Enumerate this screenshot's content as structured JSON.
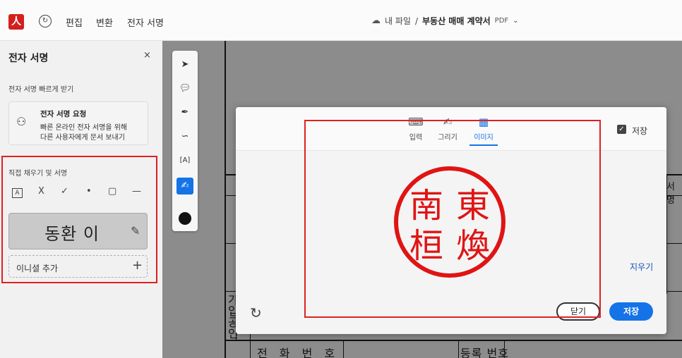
{
  "topbar": {
    "logo_glyph": "人",
    "nav": [
      "편집",
      "변환",
      "전자 서명"
    ],
    "breadcrumb": {
      "folder": "내 파일",
      "separator": "/",
      "document": "부동산 매매 계약서",
      "format": "PDF"
    }
  },
  "left_panel": {
    "title": "전자 서명",
    "close": "×",
    "quick_section": "전자 서명 빠르게 받기",
    "request_card": {
      "title": "전자 서명 요청",
      "desc_line1": "빠른 온라인 전자 서명을 위해",
      "desc_line2": "다른 사용자에게 문서 보내기"
    },
    "fill_section": "직접 채우기 및 서명",
    "tools": [
      "A",
      "X",
      "✓",
      "•",
      "▢",
      "—"
    ],
    "signature_text": "동환 이",
    "initial_label": "이니셜 추가",
    "initial_add": "+"
  },
  "rail": {
    "tools": [
      "select-tool",
      "comment-tool",
      "draw-tool",
      "lasso-tool",
      "text-tool",
      "sign-tool",
      "color-picker"
    ]
  },
  "document": {
    "row_phone": "전 화 번 호",
    "row_register": "등록 번호",
    "vertical_chars": [
      "가",
      "입",
      "공",
      "인"
    ],
    "edge_text": "서 명"
  },
  "modal": {
    "tabs": [
      {
        "label": "입력",
        "icon": "keyboard-icon"
      },
      {
        "label": "그리기",
        "icon": "pen-draw-icon"
      },
      {
        "label": "이미지",
        "icon": "image-icon"
      }
    ],
    "active_tab": "이미지",
    "save_checkbox_label": "저장",
    "save_checked": true,
    "erase_label": "지우기",
    "close_label": "닫기",
    "save_label": "저장"
  },
  "seal_image": {
    "chars": [
      "東",
      "南",
      "煥",
      "桓"
    ],
    "color": "#e01414"
  },
  "colors": {
    "accent": "#1473e6",
    "highlight": "#e02020",
    "brand": "#d41f1f"
  }
}
